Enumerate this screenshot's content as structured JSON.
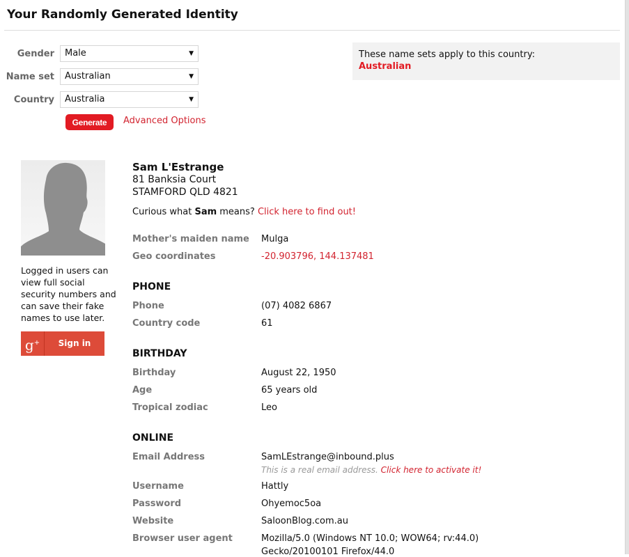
{
  "header": {
    "title": "Your Randomly Generated Identity"
  },
  "form": {
    "fields": [
      {
        "label": "Gender",
        "value": "Male"
      },
      {
        "label": "Name set",
        "value": "Australian"
      },
      {
        "label": "Country",
        "value": "Australia"
      }
    ],
    "generate_label": "Generate",
    "advanced_label": "Advanced Options",
    "dropdown_arrow": "▼"
  },
  "info_box": {
    "text": "These name sets apply to this country:",
    "country": "Australian"
  },
  "sidebar": {
    "login_note": "Logged in users can view full social security numbers and can save their fake names to use later.",
    "signin_icon": "g",
    "signin_icon_plus": "+",
    "signin_label": "Sign in"
  },
  "identity": {
    "name": "Sam L'Estrange",
    "address_line1": "81 Banksia Court",
    "address_line2": "STAMFORD QLD 4821",
    "curious_prefix": "Curious what ",
    "curious_name": "Sam",
    "curious_suffix": " means? ",
    "curious_link": "Click here to find out!",
    "mothers_maiden_name": {
      "label": "Mother's maiden name",
      "value": "Mulga"
    },
    "geo": {
      "label": "Geo coordinates",
      "value": "-20.903796, 144.137481"
    }
  },
  "sections": {
    "phone": {
      "title": "PHONE",
      "phone": {
        "label": "Phone",
        "value": "(07) 4082 6867"
      },
      "country_code": {
        "label": "Country code",
        "value": "61"
      }
    },
    "birthday": {
      "title": "BIRTHDAY",
      "birthday": {
        "label": "Birthday",
        "value": "August 22, 1950"
      },
      "age": {
        "label": "Age",
        "value": "65 years old"
      },
      "zodiac": {
        "label": "Tropical zodiac",
        "value": "Leo"
      }
    },
    "online": {
      "title": "ONLINE",
      "email": {
        "label": "Email Address",
        "value": "SamLEstrange@inbound.plus"
      },
      "email_note": "This is a real email address. ",
      "email_activate": "Click here to activate it!",
      "username": {
        "label": "Username",
        "value": "Hattly"
      },
      "password": {
        "label": "Password",
        "value": "Ohyemoc5oa"
      },
      "website": {
        "label": "Website",
        "value": "SaloonBlog.com.au"
      },
      "user_agent": {
        "label": "Browser user agent",
        "value_line1": "Mozilla/5.0 (Windows NT 10.0; WOW64; rv:44.0)",
        "value_line2": "Gecko/20100101 Firefox/44.0"
      }
    }
  }
}
